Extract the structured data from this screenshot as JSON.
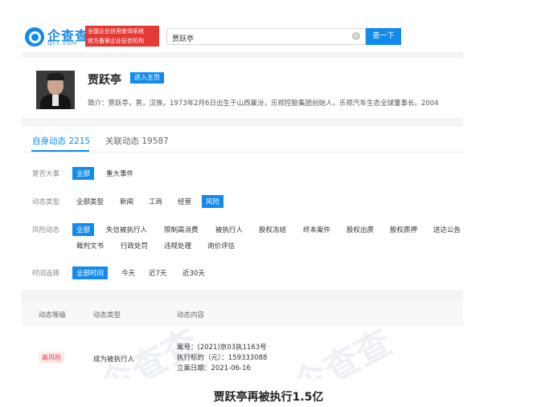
{
  "header": {
    "logo_text": "企查查",
    "logo_sub": "Qcc.com",
    "slogan_line1": "全国企业信用查询系统",
    "slogan_line2": "官方备案企业征信机构",
    "search_value": "贾跃亭",
    "search_button": "查一下"
  },
  "profile": {
    "name": "贾跃亭",
    "home_button": "进入主页",
    "intro": "简介：贾跃亭，男，汉族，1973年2月6日出生于山西襄汾，乐视控股集团创始人，乐视汽车生态全球董事长。2004"
  },
  "tabs": {
    "own": "自身动态 2215",
    "related": "关联动态 19587"
  },
  "filters": {
    "major": {
      "label": "是否大事",
      "options": [
        "全部",
        "重大事件"
      ]
    },
    "type": {
      "label": "动态类型",
      "options": [
        "全部类型",
        "新闻",
        "工商",
        "经营",
        "风险"
      ]
    },
    "risk": {
      "label": "风险动态",
      "row1": [
        "全部",
        "失信被执行人",
        "限制高消费",
        "被执行人",
        "股权冻结",
        "终本案件",
        "股权出质",
        "股权质押",
        "送达公告"
      ],
      "row2": [
        "裁判文书",
        "行政处罚",
        "违规处理",
        "询价评估"
      ]
    },
    "time": {
      "label": "时间选择",
      "options": [
        "全部时间",
        "今天",
        "近7天",
        "近30天"
      ]
    }
  },
  "table": {
    "headers": [
      "动态等级",
      "动态类型",
      "动态内容"
    ],
    "row": {
      "level": "高风险",
      "type": "成为被执行人",
      "case_no": "案号：(2021)京03执1163号",
      "amount": "执行标的（元）：159333088",
      "date": "立案日期：2021-06-16"
    },
    "watermark": "企查查"
  },
  "caption": "贾跃亭再被执行1.5亿",
  "colors": {
    "accent": "#128bed",
    "danger": "#e53935"
  }
}
